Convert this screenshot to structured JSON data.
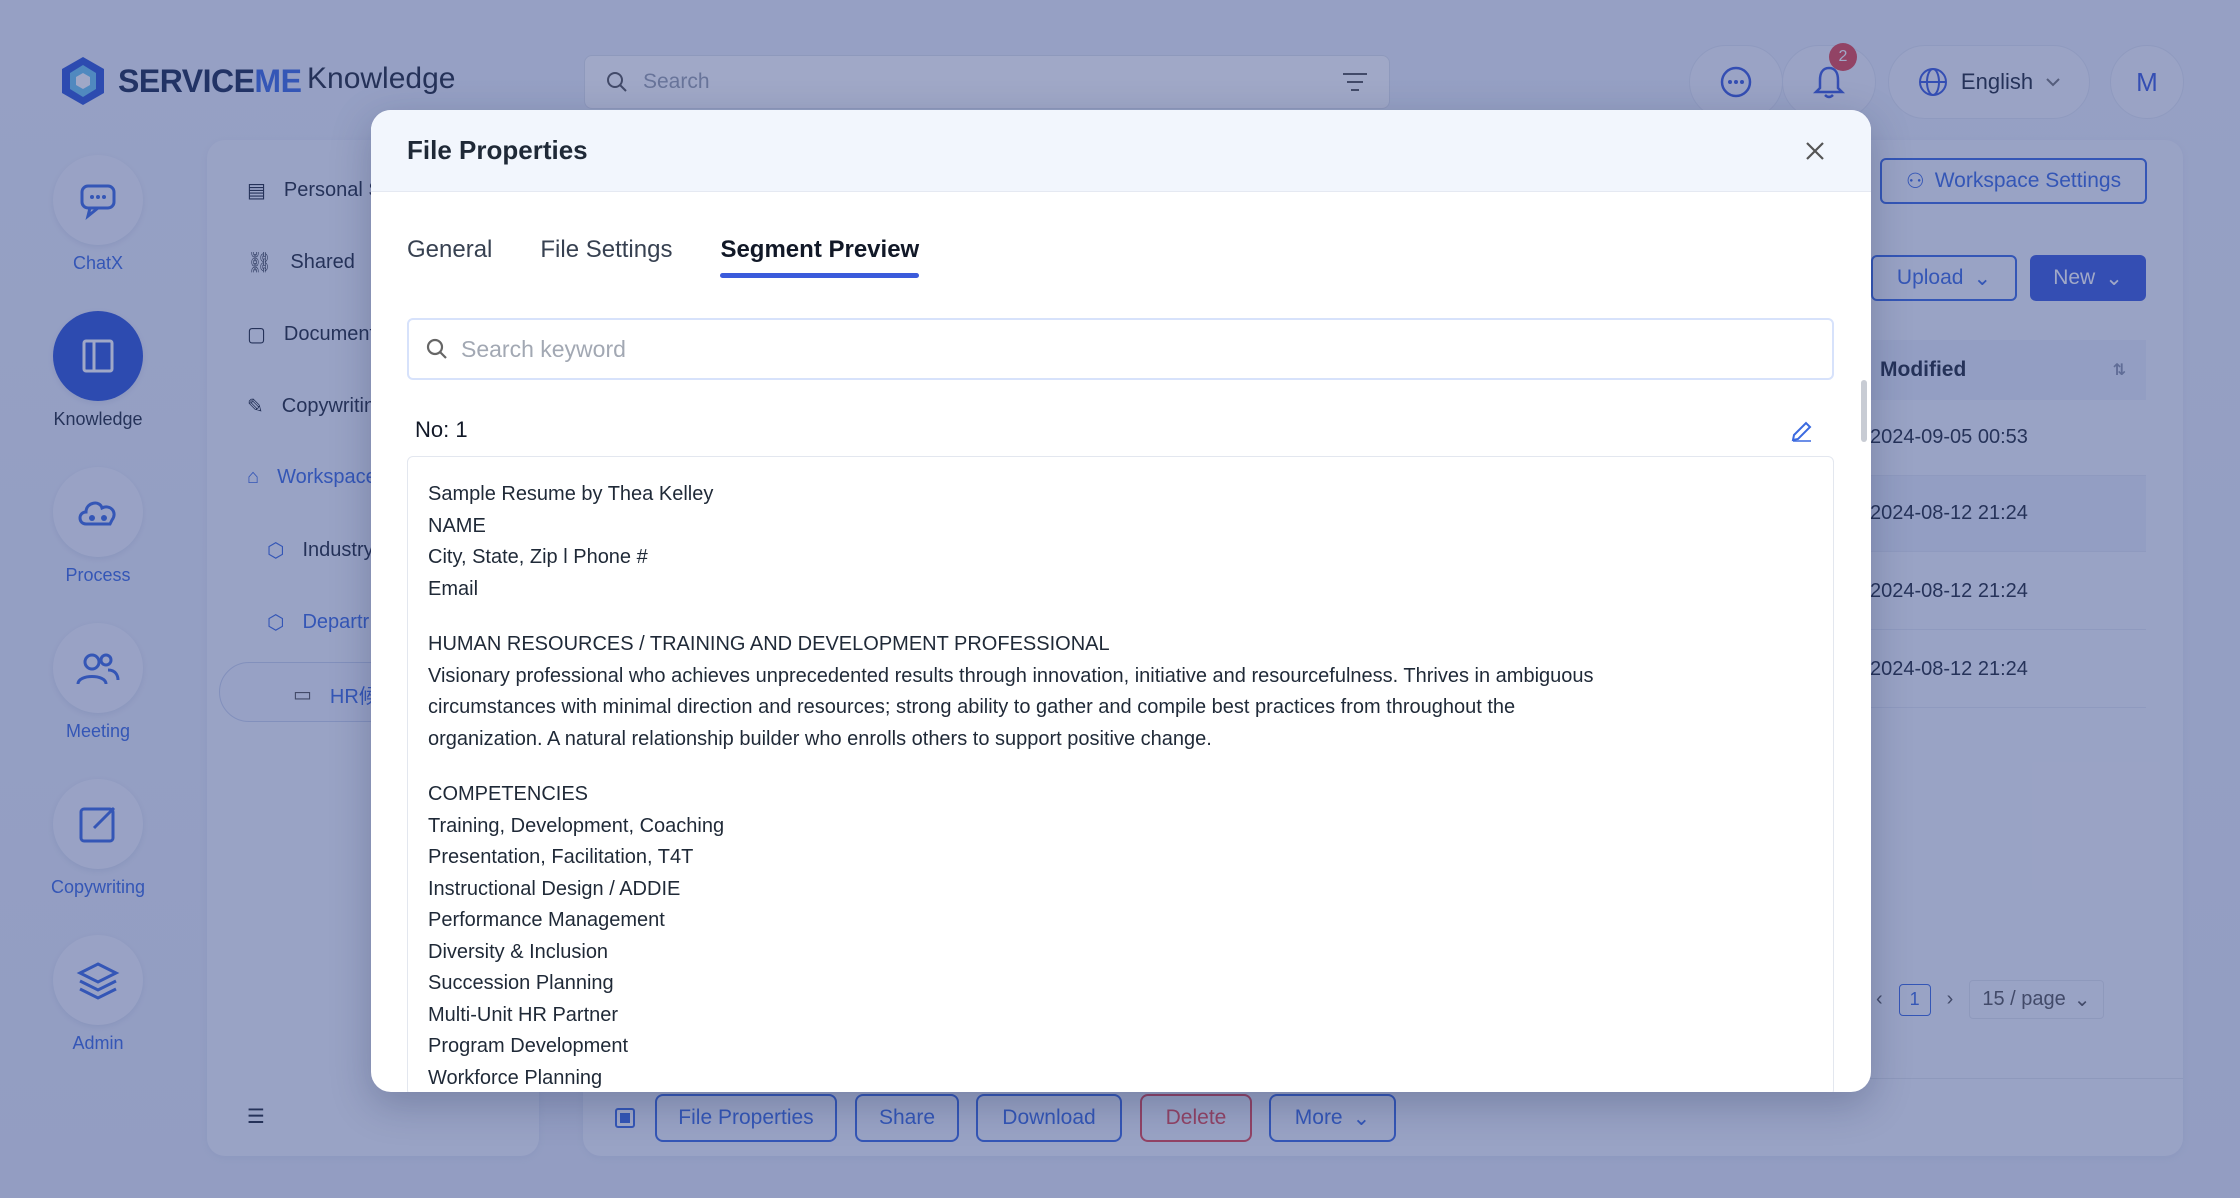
{
  "header": {
    "logo_text_a": "SERVICE",
    "logo_text_b": "ME",
    "app_title": "Knowledge",
    "search_placeholder": "Search",
    "notification_count": "2",
    "language": "English",
    "avatar_initial": "M"
  },
  "rail": [
    {
      "label": "ChatX",
      "icon": "chat-icon"
    },
    {
      "label": "Knowledge",
      "icon": "book-icon",
      "active": true
    },
    {
      "label": "Process",
      "icon": "cloud-network-icon"
    },
    {
      "label": "Meeting",
      "icon": "people-icon"
    },
    {
      "label": "Copywriting",
      "icon": "edit-square-icon"
    },
    {
      "label": "Admin",
      "icon": "layers-icon"
    }
  ],
  "sidebar": {
    "items": [
      "Personal S",
      "Shared",
      "Document",
      "Copywritin",
      "Workspace",
      "Industry",
      "Departr",
      "HR候"
    ]
  },
  "main": {
    "workspace_settings": "Workspace Settings",
    "upload": "Upload",
    "new": "New",
    "modified_header": "Modified",
    "modified_dates": [
      "2024-09-05 00:53",
      "2024-08-12 21:24",
      "2024-08-12 21:24",
      "2024-08-12 21:24"
    ],
    "page_number": "1",
    "page_size": "15 / page"
  },
  "bottom_bar": {
    "file_properties": "File Properties",
    "share": "Share",
    "download": "Download",
    "delete": "Delete",
    "more": "More"
  },
  "modal": {
    "title": "File Properties",
    "tabs": [
      "General",
      "File Settings",
      "Segment Preview"
    ],
    "active_tab": "Segment Preview",
    "search_placeholder": "Search keyword",
    "segment_label": "No: 1",
    "segment": {
      "p1": [
        "Sample Resume by Thea Kelley",
        "NAME",
        "City, State, Zip l Phone #",
        "Email"
      ],
      "p2": [
        "HUMAN RESOURCES / TRAINING AND DEVELOPMENT PROFESSIONAL",
        "Visionary professional who achieves unprecedented results through innovation, initiative and resourcefulness. Thrives in ambiguous",
        "circumstances with minimal direction and resources; strong ability to gather and compile best practices from throughout the",
        "organization. A natural relationship builder who enrolls others to support positive change."
      ],
      "p3": [
        "COMPETENCIES",
        "Training, Development, Coaching",
        "Presentation, Facilitation, T4T",
        "Instructional Design / ADDIE",
        "Performance Management",
        "Diversity & Inclusion",
        "Succession Planning",
        "Multi-Unit HR Partner",
        "Program Development",
        "Workforce Planning"
      ]
    }
  },
  "colors": {
    "accent": "#3b5bdb",
    "danger": "#e5484d",
    "overlay": "rgba(45,62,130,0.45)"
  }
}
